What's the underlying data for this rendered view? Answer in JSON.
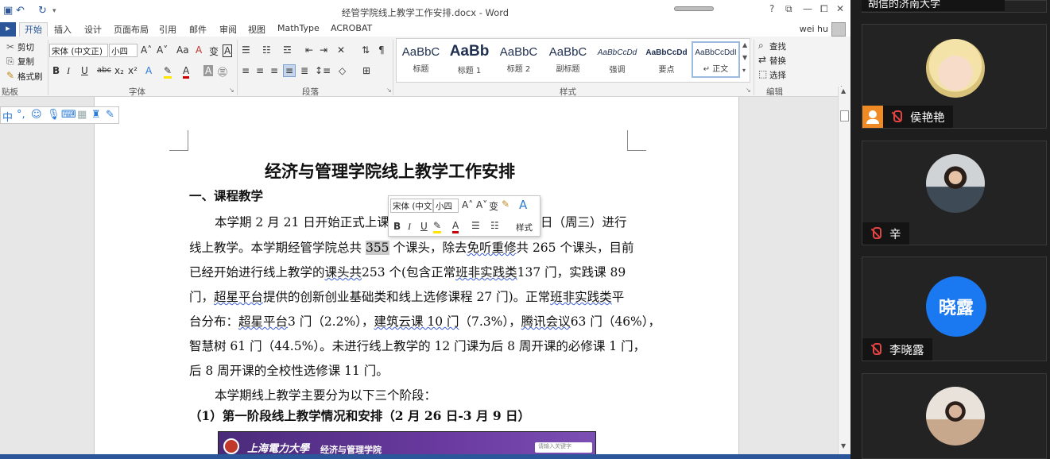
{
  "word": {
    "window_title": "经管学院线上教学工作安排.docx - Word",
    "window_controls": [
      "?",
      "⧉",
      "—",
      "⧠",
      "✕"
    ],
    "tabs": [
      "开始",
      "插入",
      "设计",
      "页面布局",
      "引用",
      "邮件",
      "审阅",
      "视图",
      "MathType",
      "ACROBAT"
    ],
    "active_tab": "开始",
    "user_name": "wei hu",
    "clipboard": {
      "cut": "剪切",
      "copy": "复制",
      "painter": "格式刷",
      "label": "贴板"
    },
    "font": {
      "name": "宋体 (中文正)",
      "size": "小四",
      "label": "字体"
    },
    "paragraph_label": "段落",
    "styles": [
      {
        "sample": "AaBbC",
        "name": "标题"
      },
      {
        "sample": "AaBb",
        "name": "标题 1"
      },
      {
        "sample": "AaBbC",
        "name": "标题 2"
      },
      {
        "sample": "AaBbC",
        "name": "副标题"
      },
      {
        "sample": "AaBbCcDd",
        "name": "强调"
      },
      {
        "sample": "AaBbCcDd",
        "name": "要点"
      },
      {
        "sample": "AaBbCcDdI",
        "name": "↵ 正文"
      }
    ],
    "styles_label": "样式",
    "editing": {
      "find": "查找",
      "replace": "替换",
      "select": "选择",
      "label": "编辑"
    },
    "mini_toolbar": {
      "font": "宋体 (中文",
      "size": "小四",
      "styles": "样式"
    },
    "document": {
      "title": "经济与管理学院线上教学工作安排",
      "heading1": "一、课程教学",
      "lines": [
        "本学期 2 月 21 日开始正式上课，",
        "日（周三）进行",
        "线上教学。本学期经管学院总共",
        "355",
        "个课头，除去",
        "免听重修",
        "共 265 个课头，目前",
        "已经开始进行线上教学的",
        "课头共",
        "253 个(包含正常",
        "班非实践类",
        "137 门，实践课 89",
        "门，",
        "超星平台",
        "提供的创新创业基础类和线上选修课程 27 门)。正常",
        "班非实践类",
        "平",
        "台分布：",
        "超星平台",
        "3 门（2.2%），",
        "建筑云课 10 门",
        "（7.3%），",
        "腾讯会议",
        "63 门（46%），",
        "智慧树 61 门（44.5%）。未进行线上教学的 12 门课为后 8 周开课的必修课 1 门，",
        "后 8 周开课的全校性选修课 11 门。",
        "本学期线上教学主要分为以下三个阶段：",
        "（1）第一阶段线上教学情况和安排（2 月 26 日-3 月 9 日）"
      ],
      "banner": {
        "school": "上海電力大學",
        "dept": "经济与管理学院",
        "search": "请输入关键字"
      }
    }
  },
  "meeting": {
    "top_name": "胡信的济南大学",
    "participants": [
      {
        "name": "侯艳艳",
        "mic": "muted",
        "camera": "off",
        "avatar": "cartoon"
      },
      {
        "name": "辛",
        "mic": "muted",
        "camera": "on",
        "avatar": "photo"
      },
      {
        "name": "李晓露",
        "mic": "muted",
        "camera": "off",
        "avatar_text": "晓露"
      },
      {
        "name": "",
        "mic": "muted",
        "camera": "on",
        "avatar": "photo"
      }
    ],
    "colors": {
      "avatar_blue": "#1a78f0",
      "mute_red": "#e24444",
      "camera_off_orange": "#f08a24"
    }
  }
}
